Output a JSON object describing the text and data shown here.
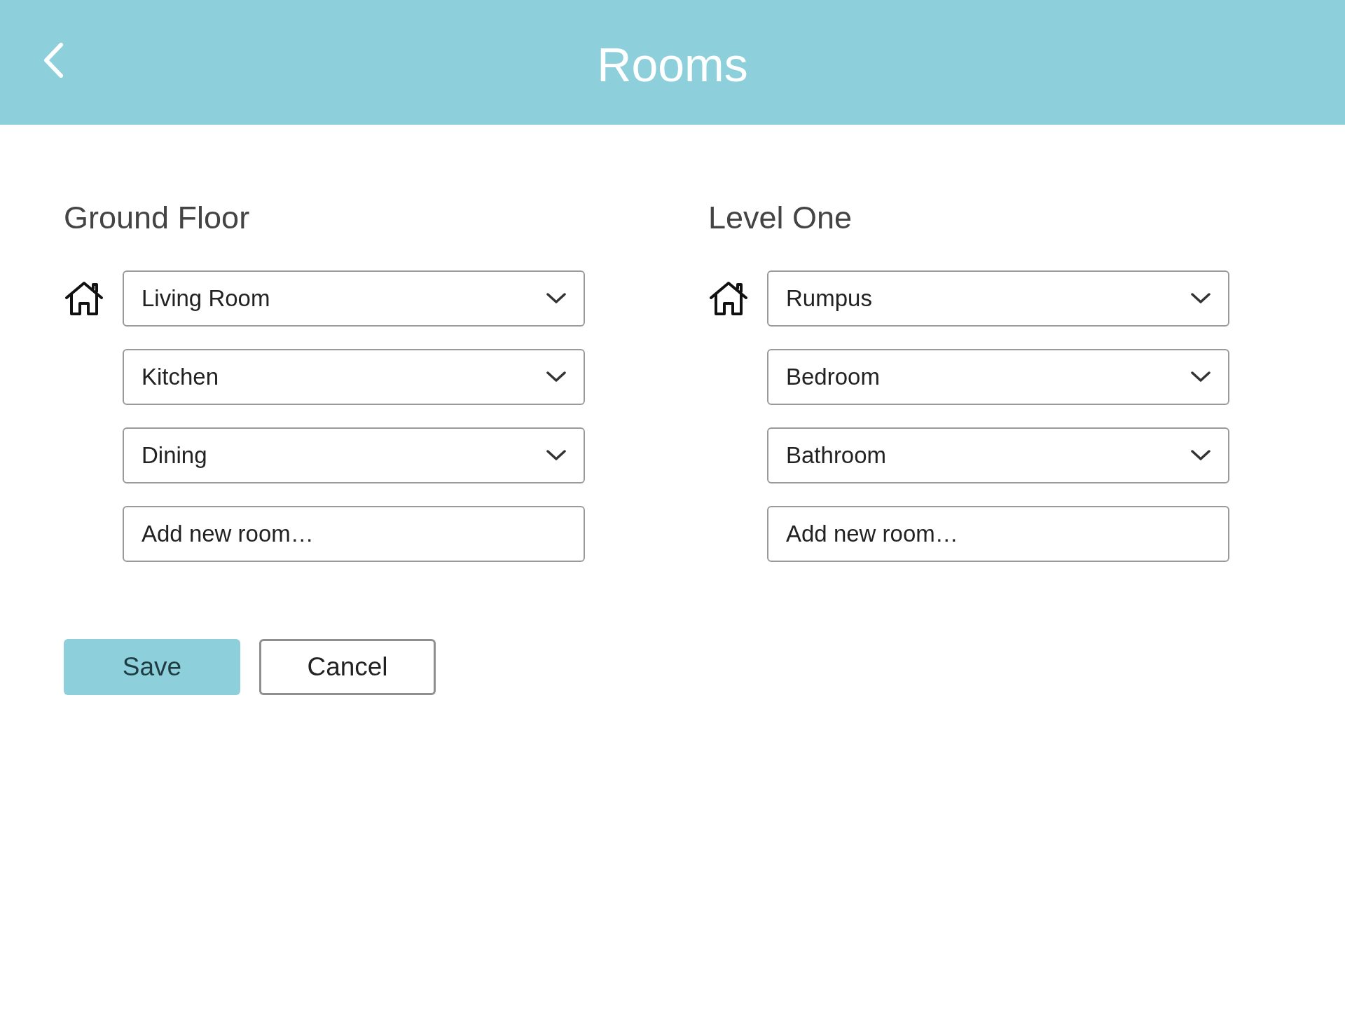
{
  "header": {
    "title": "Rooms"
  },
  "floors": [
    {
      "title": "Ground Floor",
      "rooms": [
        {
          "name": "Living Room"
        },
        {
          "name": "Kitchen"
        },
        {
          "name": "Dining"
        }
      ],
      "new_room": {
        "placeholder": "Add new room…"
      }
    },
    {
      "title": "Level One",
      "rooms": [
        {
          "name": "Rumpus"
        },
        {
          "name": "Bedroom"
        },
        {
          "name": "Bathroom"
        }
      ],
      "new_room": {
        "placeholder": "Add new room…"
      }
    }
  ],
  "buttons": [
    {
      "label": "Save",
      "kind": "primary"
    },
    {
      "label": "Cancel",
      "kind": "secondary"
    }
  ]
}
